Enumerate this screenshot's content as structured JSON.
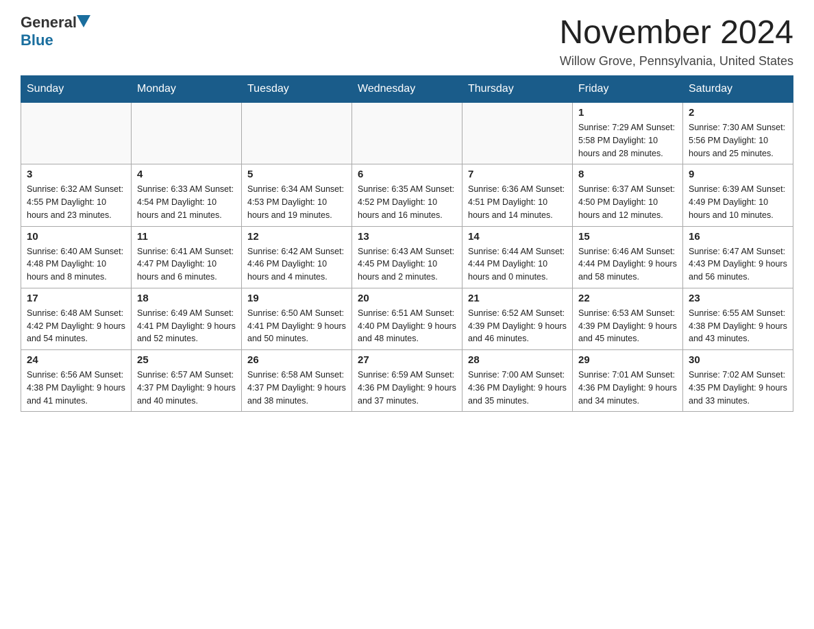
{
  "header": {
    "logo_general": "General",
    "logo_blue": "Blue",
    "month_year": "November 2024",
    "location": "Willow Grove, Pennsylvania, United States"
  },
  "calendar": {
    "days_of_week": [
      "Sunday",
      "Monday",
      "Tuesday",
      "Wednesday",
      "Thursday",
      "Friday",
      "Saturday"
    ],
    "weeks": [
      [
        {
          "day": "",
          "info": ""
        },
        {
          "day": "",
          "info": ""
        },
        {
          "day": "",
          "info": ""
        },
        {
          "day": "",
          "info": ""
        },
        {
          "day": "",
          "info": ""
        },
        {
          "day": "1",
          "info": "Sunrise: 7:29 AM\nSunset: 5:58 PM\nDaylight: 10 hours and 28 minutes."
        },
        {
          "day": "2",
          "info": "Sunrise: 7:30 AM\nSunset: 5:56 PM\nDaylight: 10 hours and 25 minutes."
        }
      ],
      [
        {
          "day": "3",
          "info": "Sunrise: 6:32 AM\nSunset: 4:55 PM\nDaylight: 10 hours and 23 minutes."
        },
        {
          "day": "4",
          "info": "Sunrise: 6:33 AM\nSunset: 4:54 PM\nDaylight: 10 hours and 21 minutes."
        },
        {
          "day": "5",
          "info": "Sunrise: 6:34 AM\nSunset: 4:53 PM\nDaylight: 10 hours and 19 minutes."
        },
        {
          "day": "6",
          "info": "Sunrise: 6:35 AM\nSunset: 4:52 PM\nDaylight: 10 hours and 16 minutes."
        },
        {
          "day": "7",
          "info": "Sunrise: 6:36 AM\nSunset: 4:51 PM\nDaylight: 10 hours and 14 minutes."
        },
        {
          "day": "8",
          "info": "Sunrise: 6:37 AM\nSunset: 4:50 PM\nDaylight: 10 hours and 12 minutes."
        },
        {
          "day": "9",
          "info": "Sunrise: 6:39 AM\nSunset: 4:49 PM\nDaylight: 10 hours and 10 minutes."
        }
      ],
      [
        {
          "day": "10",
          "info": "Sunrise: 6:40 AM\nSunset: 4:48 PM\nDaylight: 10 hours and 8 minutes."
        },
        {
          "day": "11",
          "info": "Sunrise: 6:41 AM\nSunset: 4:47 PM\nDaylight: 10 hours and 6 minutes."
        },
        {
          "day": "12",
          "info": "Sunrise: 6:42 AM\nSunset: 4:46 PM\nDaylight: 10 hours and 4 minutes."
        },
        {
          "day": "13",
          "info": "Sunrise: 6:43 AM\nSunset: 4:45 PM\nDaylight: 10 hours and 2 minutes."
        },
        {
          "day": "14",
          "info": "Sunrise: 6:44 AM\nSunset: 4:44 PM\nDaylight: 10 hours and 0 minutes."
        },
        {
          "day": "15",
          "info": "Sunrise: 6:46 AM\nSunset: 4:44 PM\nDaylight: 9 hours and 58 minutes."
        },
        {
          "day": "16",
          "info": "Sunrise: 6:47 AM\nSunset: 4:43 PM\nDaylight: 9 hours and 56 minutes."
        }
      ],
      [
        {
          "day": "17",
          "info": "Sunrise: 6:48 AM\nSunset: 4:42 PM\nDaylight: 9 hours and 54 minutes."
        },
        {
          "day": "18",
          "info": "Sunrise: 6:49 AM\nSunset: 4:41 PM\nDaylight: 9 hours and 52 minutes."
        },
        {
          "day": "19",
          "info": "Sunrise: 6:50 AM\nSunset: 4:41 PM\nDaylight: 9 hours and 50 minutes."
        },
        {
          "day": "20",
          "info": "Sunrise: 6:51 AM\nSunset: 4:40 PM\nDaylight: 9 hours and 48 minutes."
        },
        {
          "day": "21",
          "info": "Sunrise: 6:52 AM\nSunset: 4:39 PM\nDaylight: 9 hours and 46 minutes."
        },
        {
          "day": "22",
          "info": "Sunrise: 6:53 AM\nSunset: 4:39 PM\nDaylight: 9 hours and 45 minutes."
        },
        {
          "day": "23",
          "info": "Sunrise: 6:55 AM\nSunset: 4:38 PM\nDaylight: 9 hours and 43 minutes."
        }
      ],
      [
        {
          "day": "24",
          "info": "Sunrise: 6:56 AM\nSunset: 4:38 PM\nDaylight: 9 hours and 41 minutes."
        },
        {
          "day": "25",
          "info": "Sunrise: 6:57 AM\nSunset: 4:37 PM\nDaylight: 9 hours and 40 minutes."
        },
        {
          "day": "26",
          "info": "Sunrise: 6:58 AM\nSunset: 4:37 PM\nDaylight: 9 hours and 38 minutes."
        },
        {
          "day": "27",
          "info": "Sunrise: 6:59 AM\nSunset: 4:36 PM\nDaylight: 9 hours and 37 minutes."
        },
        {
          "day": "28",
          "info": "Sunrise: 7:00 AM\nSunset: 4:36 PM\nDaylight: 9 hours and 35 minutes."
        },
        {
          "day": "29",
          "info": "Sunrise: 7:01 AM\nSunset: 4:36 PM\nDaylight: 9 hours and 34 minutes."
        },
        {
          "day": "30",
          "info": "Sunrise: 7:02 AM\nSunset: 4:35 PM\nDaylight: 9 hours and 33 minutes."
        }
      ]
    ]
  }
}
